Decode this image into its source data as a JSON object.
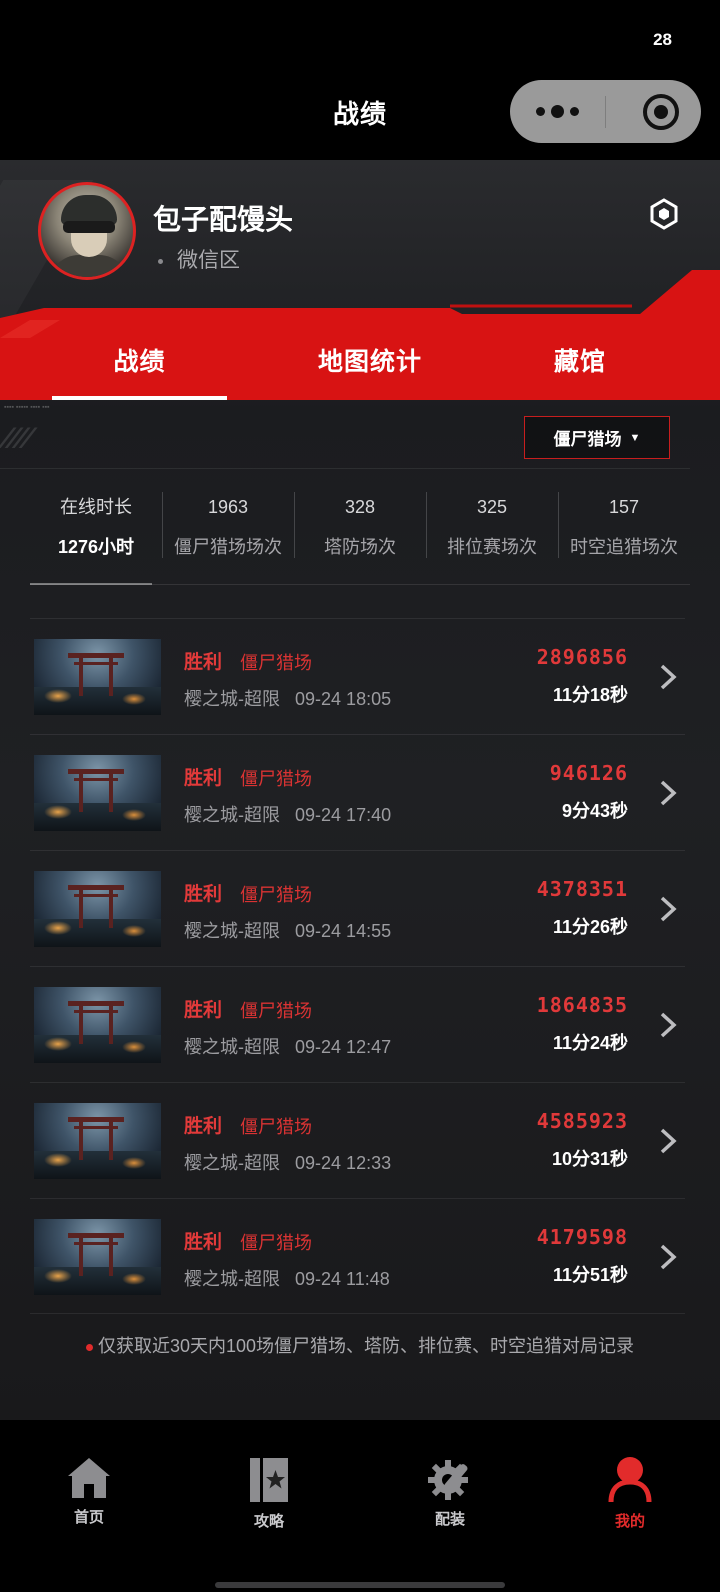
{
  "status_bar": {
    "time": "28"
  },
  "nav": {
    "title": "战绩",
    "more_icon": "more-dots-icon",
    "close_icon": "target-close-icon"
  },
  "profile": {
    "nickname": "包子配馒头",
    "server": "微信区",
    "settings_icon": "hexagon-settings-icon"
  },
  "tabs": [
    {
      "label": "战绩",
      "active": true
    },
    {
      "label": "地图统计",
      "active": false
    },
    {
      "label": "藏馆",
      "active": false
    }
  ],
  "mode_select": {
    "value": "僵尸猎场"
  },
  "stats": [
    {
      "top": "在线时长",
      "bottom": "1276小时"
    },
    {
      "top": "1963",
      "bottom": "僵尸猎场场次"
    },
    {
      "top": "328",
      "bottom": "塔防场次"
    },
    {
      "top": "325",
      "bottom": "排位赛场次"
    },
    {
      "top": "157",
      "bottom": "时空追猎场次"
    }
  ],
  "matches": [
    {
      "result": "胜利",
      "mode": "僵尸猎场",
      "map": "樱之城-超限",
      "time": "09-24 18:05",
      "score": "2896856",
      "duration": "11分18秒"
    },
    {
      "result": "胜利",
      "mode": "僵尸猎场",
      "map": "樱之城-超限",
      "time": "09-24 17:40",
      "score": "946126",
      "duration": "9分43秒"
    },
    {
      "result": "胜利",
      "mode": "僵尸猎场",
      "map": "樱之城-超限",
      "time": "09-24 14:55",
      "score": "4378351",
      "duration": "11分26秒"
    },
    {
      "result": "胜利",
      "mode": "僵尸猎场",
      "map": "樱之城-超限",
      "time": "09-24 12:47",
      "score": "1864835",
      "duration": "11分24秒"
    },
    {
      "result": "胜利",
      "mode": "僵尸猎场",
      "map": "樱之城-超限",
      "time": "09-24 12:33",
      "score": "4585923",
      "duration": "10分31秒"
    },
    {
      "result": "胜利",
      "mode": "僵尸猎场",
      "map": "樱之城-超限",
      "time": "09-24 11:48",
      "score": "4179598",
      "duration": "11分51秒"
    }
  ],
  "footnote": "仅获取近30天内100场僵尸猎场、塔防、排位赛、时空追猎对局记录",
  "tabbar": [
    {
      "label": "首页",
      "icon": "home-icon",
      "active": false
    },
    {
      "label": "攻略",
      "icon": "guide-book-icon",
      "active": false
    },
    {
      "label": "配装",
      "icon": "gear-wrench-icon",
      "active": false
    },
    {
      "label": "我的",
      "icon": "user-icon",
      "active": true
    }
  ],
  "colors": {
    "accent": "#e02b2b",
    "band": "#d81313",
    "background": "#1c1d20"
  }
}
